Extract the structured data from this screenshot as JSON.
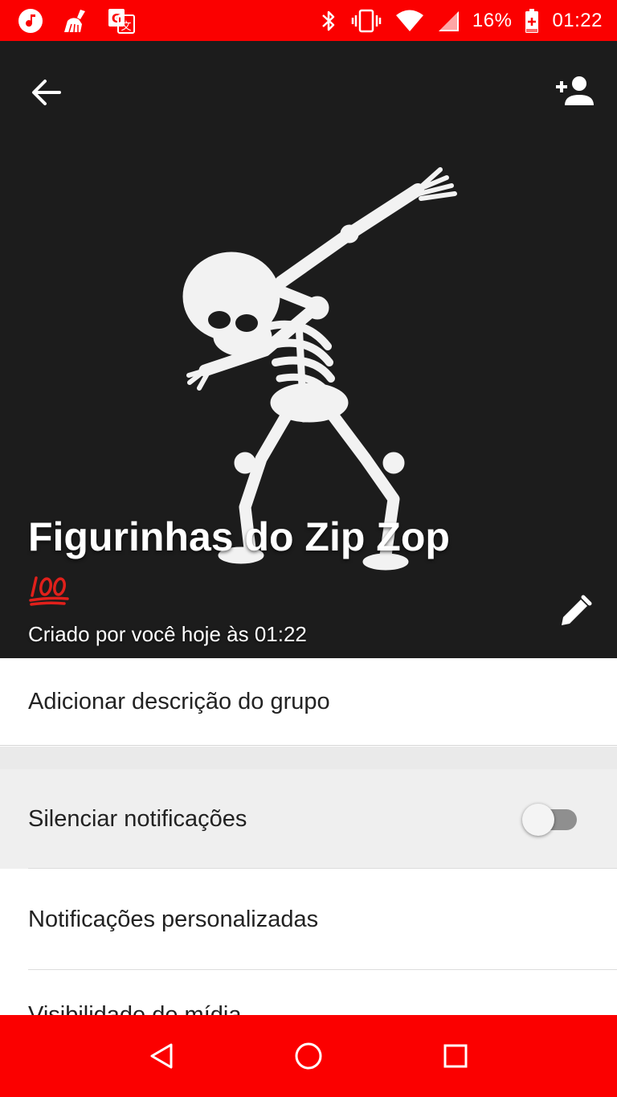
{
  "status_bar": {
    "battery_percent": "16%",
    "time": "01:22",
    "left_icons": [
      "music-note-icon",
      "broom-icon",
      "translate-icon"
    ],
    "right_icons": [
      "bluetooth-icon",
      "vibrate-icon",
      "wifi-icon",
      "cell-signal-icon",
      "battery-icon"
    ]
  },
  "header": {
    "group_name": "Figurinhas do Zip Zop",
    "emoji": "💯",
    "created_text": "Criado por você hoje às 01:22",
    "back_icon": "arrow-back-icon",
    "add_member_icon": "person-add-icon",
    "edit_icon": "pencil-icon",
    "photo": "dabbing-skeleton-image"
  },
  "settings": {
    "description_label": "Adicionar descrição do grupo",
    "mute_label": "Silenciar notificações",
    "mute_enabled": false,
    "custom_notifications_label": "Notificações personalizadas",
    "media_visibility_label": "Visibilidade de mídia"
  },
  "nav_bar": {
    "icons": [
      "back-triangle-icon",
      "home-circle-icon",
      "recents-square-icon"
    ]
  },
  "colors": {
    "system_bar": "#fb0000",
    "header_bg": "#1a1a1a",
    "emoji_red": "#e0201b"
  }
}
